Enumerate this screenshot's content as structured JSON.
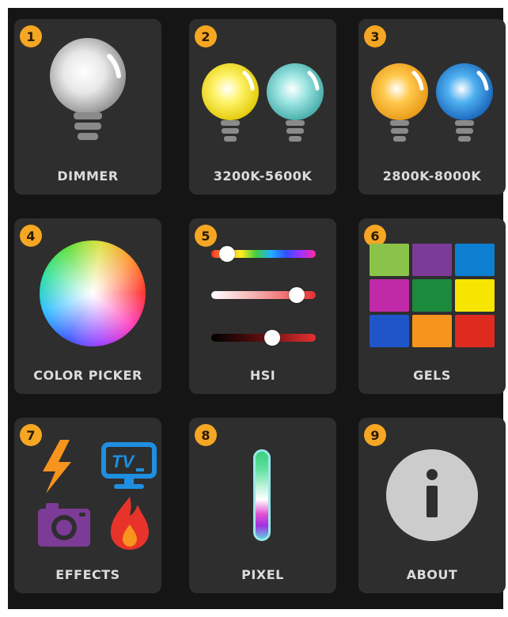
{
  "tiles": [
    {
      "num": "1",
      "label": "DIMMER"
    },
    {
      "num": "2",
      "label": "3200K-5600K"
    },
    {
      "num": "3",
      "label": "2800K-8000K"
    },
    {
      "num": "4",
      "label": "COLOR PICKER"
    },
    {
      "num": "5",
      "label": "HSI"
    },
    {
      "num": "6",
      "label": "GELS"
    },
    {
      "num": "7",
      "label": "EFFECTS"
    },
    {
      "num": "8",
      "label": "PIXEL"
    },
    {
      "num": "9",
      "label": "ABOUT"
    }
  ],
  "icons": {
    "tile1": [
      "white-bulb-icon"
    ],
    "tile2": [
      "yellow-bulb-icon",
      "cyan-bulb-icon"
    ],
    "tile3": [
      "orange-bulb-icon",
      "blue-bulb-icon"
    ],
    "tile4": [
      "color-wheel-icon"
    ],
    "tile5": [
      "hue-slider",
      "saturation-slider",
      "intensity-slider"
    ],
    "tile6": [
      "gel-swatches"
    ],
    "tile7": [
      "lightning-icon",
      "tv-icon",
      "camera-icon",
      "fire-icon"
    ],
    "tile8": [
      "pixel-tube-icon"
    ],
    "tile9": [
      "info-icon"
    ]
  },
  "hsi": {
    "hue": 0.15,
    "saturation": 0.82,
    "intensity": 0.58
  },
  "gels": [
    "#8bc34a",
    "#7b3b96",
    "#0d7fd1",
    "#c02aa8",
    "#1b8a3d",
    "#f5e500",
    "#1f55c9",
    "#f7941d",
    "#de2a1f"
  ],
  "colors": {
    "badge": "#f5a623",
    "tile": "#2e2e2e",
    "background": "#151515"
  },
  "tv_text": "TV"
}
